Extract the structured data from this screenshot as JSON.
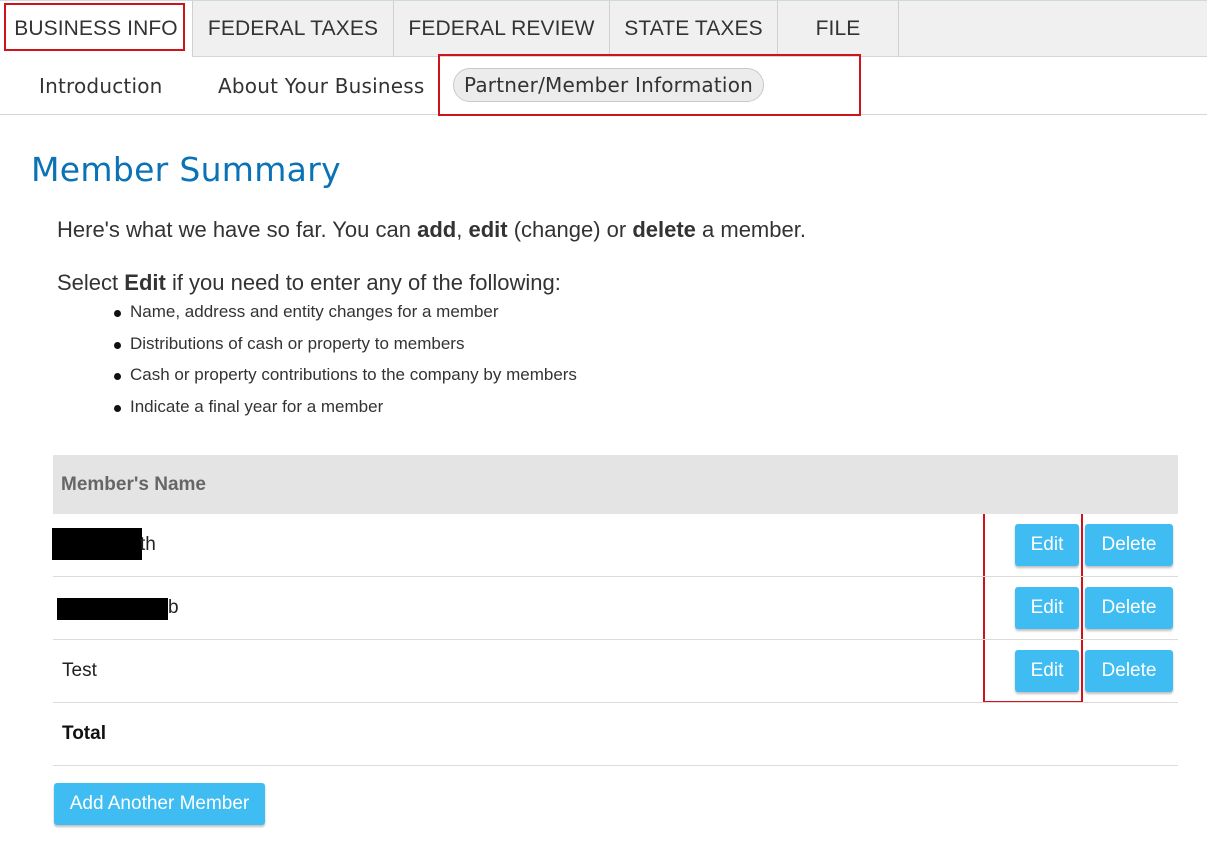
{
  "top_tabs": [
    {
      "label": "BUSINESS INFO",
      "active": true
    },
    {
      "label": "FEDERAL TAXES"
    },
    {
      "label": "FEDERAL REVIEW"
    },
    {
      "label": "STATE TAXES"
    },
    {
      "label": "FILE"
    }
  ],
  "sub_nav": {
    "items": [
      "Introduction",
      "About Your Business",
      "Partner/Member Information"
    ],
    "active": "Partner/Member Information"
  },
  "page": {
    "title": "Member Summary",
    "intro": {
      "p1": "Here's what we have so far. You can ",
      "b1": "add",
      "p2": ", ",
      "b2": "edit",
      "p3": " (change) or ",
      "b3": "delete",
      "p4": " a member."
    },
    "select_line": {
      "p1": "Select ",
      "b1": "Edit",
      "p2": " if you need to enter any of the following:"
    },
    "bullets": [
      "Name, address and entity changes for a member",
      "Distributions of cash or property to members",
      "Cash or property contributions to the company by members",
      "Indicate a final year for a member"
    ]
  },
  "table": {
    "header": "Member's Name",
    "rows": [
      {
        "name_visible": "th",
        "redacted": true,
        "edit_label": "Edit",
        "delete_label": "Delete"
      },
      {
        "name_visible": "b",
        "redacted": true,
        "edit_label": "Edit",
        "delete_label": "Delete"
      },
      {
        "name_visible": "Test",
        "redacted": false,
        "edit_label": "Edit",
        "delete_label": "Delete"
      }
    ],
    "total_label": "Total"
  },
  "add_button_label": "Add Another Member",
  "colors": {
    "accent_blue": "#3fbdf2",
    "title_blue": "#0a72b5",
    "highlight_red": "#d0121b"
  }
}
